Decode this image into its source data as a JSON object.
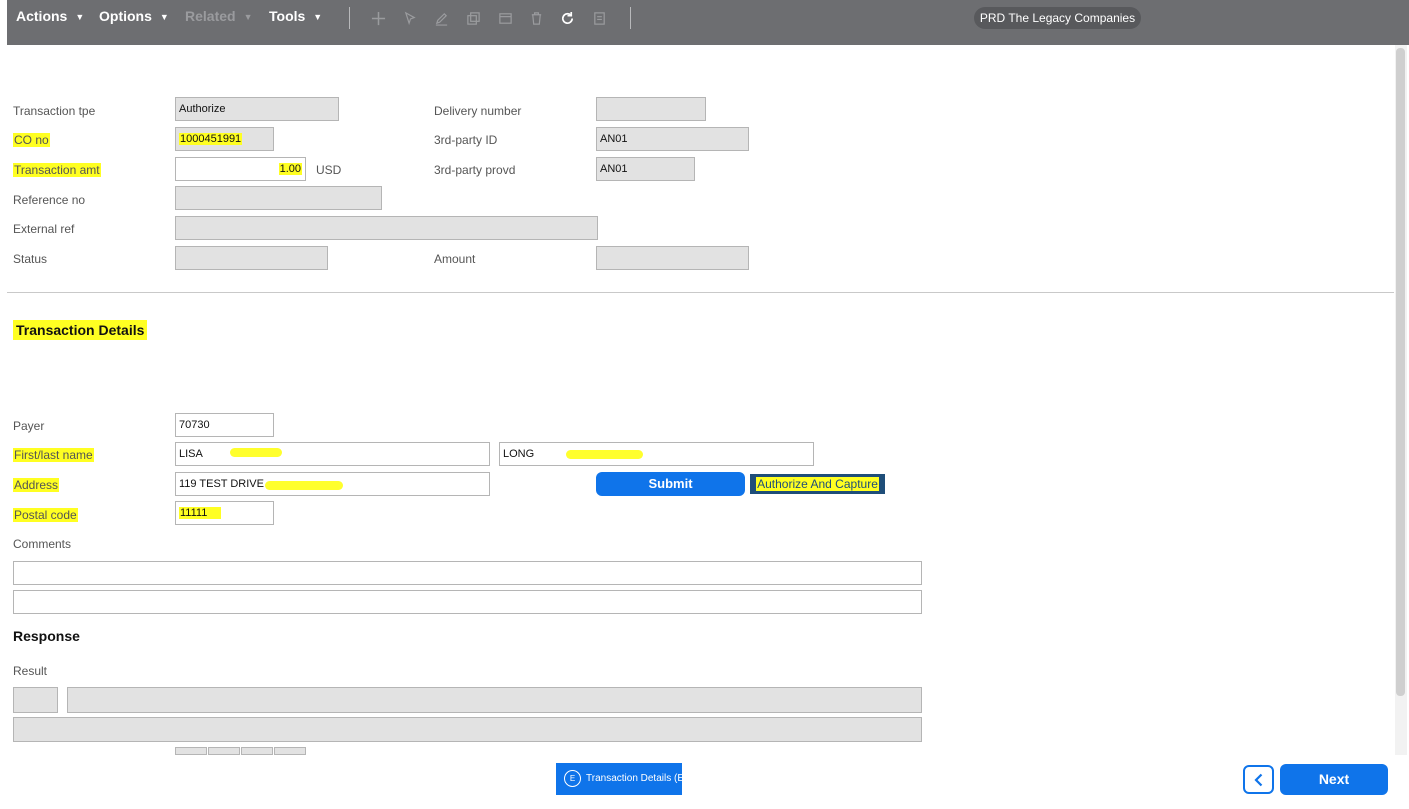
{
  "toolbar": {
    "menus": {
      "actions": "Actions",
      "options": "Options",
      "related": "Related",
      "tools": "Tools"
    },
    "icons": [
      "add-icon",
      "select-icon",
      "edit-icon",
      "copy-icon",
      "window-icon",
      "delete-icon",
      "refresh-icon",
      "notes-icon"
    ],
    "company": "PRD The Legacy Companies"
  },
  "header_form": {
    "transaction_type": {
      "label": "Transaction tpe",
      "value": "Authorize"
    },
    "co_no": {
      "label": "CO no",
      "value": "1000451991"
    },
    "transaction_amt": {
      "label": "Transaction amt",
      "value": "1.00",
      "currency": "USD"
    },
    "reference_no": {
      "label": "Reference no",
      "value": ""
    },
    "external_ref": {
      "label": "External ref",
      "value": ""
    },
    "status": {
      "label": "Status",
      "value": ""
    },
    "delivery_number": {
      "label": "Delivery number",
      "value": ""
    },
    "third_party_id": {
      "label": "3rd-party ID",
      "value": "AN01"
    },
    "third_party_provd": {
      "label": "3rd-party provd",
      "value": "AN01"
    },
    "amount": {
      "label": "Amount",
      "value": ""
    }
  },
  "details": {
    "title": "Transaction Details",
    "payer": {
      "label": "Payer",
      "value": "70730"
    },
    "name": {
      "label": "First/last name",
      "first": "LISA",
      "last": "LONG"
    },
    "address": {
      "label": "Address",
      "value": "119 TEST DRIVE"
    },
    "postal_code": {
      "label": "Postal code",
      "value": "11111"
    },
    "comments": {
      "label": "Comments",
      "line1": "",
      "line2": ""
    },
    "submit_label": "Submit",
    "authorize_capture_label": "Authorize And Capture"
  },
  "response": {
    "title": "Response",
    "result_label": "Result",
    "result_code": "",
    "result_text": "",
    "result_detail": ""
  },
  "footer": {
    "tab_key": "E",
    "tab_label": "Transaction Details (E)",
    "next_label": "Next"
  },
  "colors": {
    "toolbar": "#6d6e71",
    "primary": "#0f74ea",
    "highlight": "#ffff22",
    "dark_button": "#1f4e79"
  }
}
